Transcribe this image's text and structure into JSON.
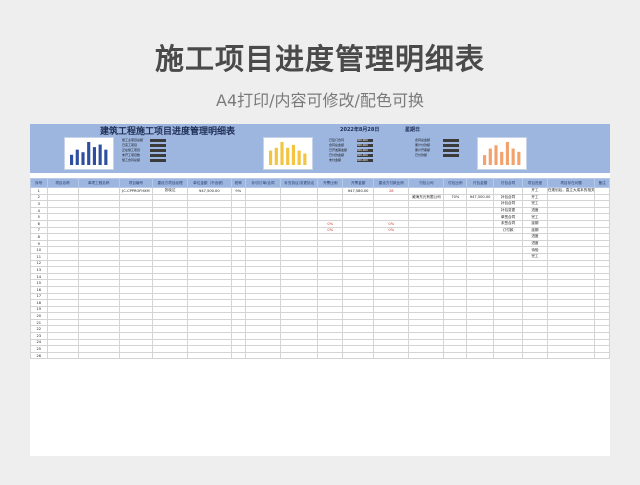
{
  "page": {
    "title": "施工项目进度管理明细表",
    "subtitle": "A4打印/内容可修改/配色可换"
  },
  "sheet": {
    "title": "建筑工程施工项目进度管理明细表",
    "date": "2022年8月28日",
    "weekday": "星期日",
    "summary_1": [
      {
        "k": "施工主项目总额"
      },
      {
        "k": "已完工项目"
      },
      {
        "k": "正在施工项目"
      },
      {
        "k": "未开工项目数"
      },
      {
        "k": "施工合同总额"
      }
    ],
    "summary_2": [
      {
        "k": "已签订合同",
        "v": "000,000"
      },
      {
        "k": "合同总金额",
        "v": "000,000"
      },
      {
        "k": "已开发票金额",
        "v": "000,000"
      },
      {
        "k": "已付款金额",
        "v": "000,000"
      },
      {
        "k": "未付金额",
        "v": "000,000"
      }
    ],
    "summary_3": [
      {
        "k": "合同总金额"
      },
      {
        "k": "累计付款额"
      },
      {
        "k": "累计开票额"
      },
      {
        "k": "已付款额"
      }
    ],
    "columns": [
      "序号",
      "项目名称",
      "单项工程名称",
      "项目编号",
      "建设方项目经理",
      "单位金额（不含税）",
      "税率",
      "补切订单/合同",
      "补充协议/变更协议",
      "开票比例",
      "开票金额",
      "建设方付款比例",
      "付包公司",
      "付包比例",
      "付包金额",
      "付包合同",
      "项目进度",
      "项目存在问题",
      "备注"
    ],
    "rows": [
      [
        "1",
        "",
        "",
        "JC-CPPROFHXM",
        "张晓达",
        "¥47,500.00",
        "9%",
        "",
        "",
        "",
        "¥47,580.00",
        "28",
        "",
        "",
        "",
        "",
        "开工",
        "在规划后，直立大成本的相关大幅或者",
        "",
        ""
      ],
      [
        "2",
        "",
        "",
        "",
        "",
        "",
        "",
        "",
        "",
        "",
        "",
        "",
        "威海东元有限公司",
        "70%",
        "¥47,500.00",
        "补包合同",
        "开工",
        "",
        "",
        ""
      ],
      [
        "3",
        "",
        "",
        "",
        "",
        "",
        "",
        "",
        "",
        "",
        "",
        "",
        "",
        "",
        "",
        "补包合同",
        "完工",
        "",
        "",
        ""
      ],
      [
        "4",
        "",
        "",
        "",
        "",
        "",
        "",
        "",
        "",
        "",
        "",
        "",
        "",
        "",
        "",
        "补包变更",
        "进度",
        "",
        "",
        ""
      ],
      [
        "5",
        "",
        "",
        "",
        "",
        "",
        "",
        "",
        "",
        "",
        "",
        "",
        "",
        "",
        "",
        "单签合同",
        "完工",
        "",
        "",
        ""
      ],
      [
        "6",
        "",
        "",
        "",
        "",
        "",
        "",
        "",
        "",
        "0%",
        "",
        "0%",
        "",
        "",
        "",
        "未签合同",
        "延期",
        "",
        "",
        ""
      ],
      [
        "7",
        "",
        "",
        "",
        "",
        "",
        "",
        "",
        "",
        "0%",
        "",
        "0%",
        "",
        "",
        "",
        "订付款",
        "延期",
        "",
        "",
        ""
      ],
      [
        "8",
        "",
        "",
        "",
        "",
        "",
        "",
        "",
        "",
        "",
        "",
        "",
        "",
        "",
        "",
        "",
        "进度",
        "",
        "",
        ""
      ],
      [
        "9",
        "",
        "",
        "",
        "",
        "",
        "",
        "",
        "",
        "",
        "",
        "",
        "",
        "",
        "",
        "",
        "进度",
        "",
        "",
        ""
      ],
      [
        "10",
        "",
        "",
        "",
        "",
        "",
        "",
        "",
        "",
        "",
        "",
        "",
        "",
        "",
        "",
        "",
        "待验",
        "",
        "",
        ""
      ],
      [
        "11",
        "",
        "",
        "",
        "",
        "",
        "",
        "",
        "",
        "",
        "",
        "",
        "",
        "",
        "",
        "",
        "完工",
        "",
        "",
        ""
      ],
      [
        "12",
        "",
        "",
        "",
        "",
        "",
        "",
        "",
        "",
        "",
        "",
        "",
        "",
        "",
        "",
        "",
        "",
        "",
        "",
        ""
      ],
      [
        "13",
        "",
        "",
        "",
        "",
        "",
        "",
        "",
        "",
        "",
        "",
        "",
        "",
        "",
        "",
        "",
        "",
        "",
        "",
        ""
      ],
      [
        "14",
        "",
        "",
        "",
        "",
        "",
        "",
        "",
        "",
        "",
        "",
        "",
        "",
        "",
        "",
        "",
        "",
        "",
        "",
        ""
      ],
      [
        "15",
        "",
        "",
        "",
        "",
        "",
        "",
        "",
        "",
        "",
        "",
        "",
        "",
        "",
        "",
        "",
        "",
        "",
        "",
        ""
      ],
      [
        "16",
        "",
        "",
        "",
        "",
        "",
        "",
        "",
        "",
        "",
        "",
        "",
        "",
        "",
        "",
        "",
        "",
        "",
        "",
        ""
      ],
      [
        "17",
        "",
        "",
        "",
        "",
        "",
        "",
        "",
        "",
        "",
        "",
        "",
        "",
        "",
        "",
        "",
        "",
        "",
        "",
        ""
      ],
      [
        "18",
        "",
        "",
        "",
        "",
        "",
        "",
        "",
        "",
        "",
        "",
        "",
        "",
        "",
        "",
        "",
        "",
        "",
        "",
        ""
      ],
      [
        "19",
        "",
        "",
        "",
        "",
        "",
        "",
        "",
        "",
        "",
        "",
        "",
        "",
        "",
        "",
        "",
        "",
        "",
        "",
        ""
      ],
      [
        "20",
        "",
        "",
        "",
        "",
        "",
        "",
        "",
        "",
        "",
        "",
        "",
        "",
        "",
        "",
        "",
        "",
        "",
        "",
        ""
      ],
      [
        "21",
        "",
        "",
        "",
        "",
        "",
        "",
        "",
        "",
        "",
        "",
        "",
        "",
        "",
        "",
        "",
        "",
        "",
        "",
        ""
      ],
      [
        "22",
        "",
        "",
        "",
        "",
        "",
        "",
        "",
        "",
        "",
        "",
        "",
        "",
        "",
        "",
        "",
        "",
        "",
        "",
        ""
      ],
      [
        "23",
        "",
        "",
        "",
        "",
        "",
        "",
        "",
        "",
        "",
        "",
        "",
        "",
        "",
        "",
        "",
        "",
        "",
        "",
        ""
      ],
      [
        "24",
        "",
        "",
        "",
        "",
        "",
        "",
        "",
        "",
        "",
        "",
        "",
        "",
        "",
        "",
        "",
        "",
        "",
        "",
        ""
      ],
      [
        "25",
        "",
        "",
        "",
        "",
        "",
        "",
        "",
        "",
        "",
        "",
        "",
        "",
        "",
        "",
        "",
        "",
        "",
        "",
        ""
      ],
      [
        "26",
        "",
        "",
        "",
        "",
        "",
        "",
        "",
        "",
        "",
        "",
        "",
        "",
        "",
        "",
        "",
        "",
        "",
        "",
        ""
      ]
    ],
    "mini_chart_1": {
      "color": "#2e4ea0",
      "values": [
        4,
        6,
        5,
        9,
        7,
        8,
        6
      ]
    },
    "mini_chart_2": {
      "color": "#f3c43f",
      "values": [
        5,
        6,
        8,
        6,
        7,
        5,
        4
      ]
    },
    "mini_chart_3": {
      "color": "#f1a26d",
      "values": [
        3,
        5,
        6,
        4,
        7,
        5,
        4
      ]
    }
  }
}
